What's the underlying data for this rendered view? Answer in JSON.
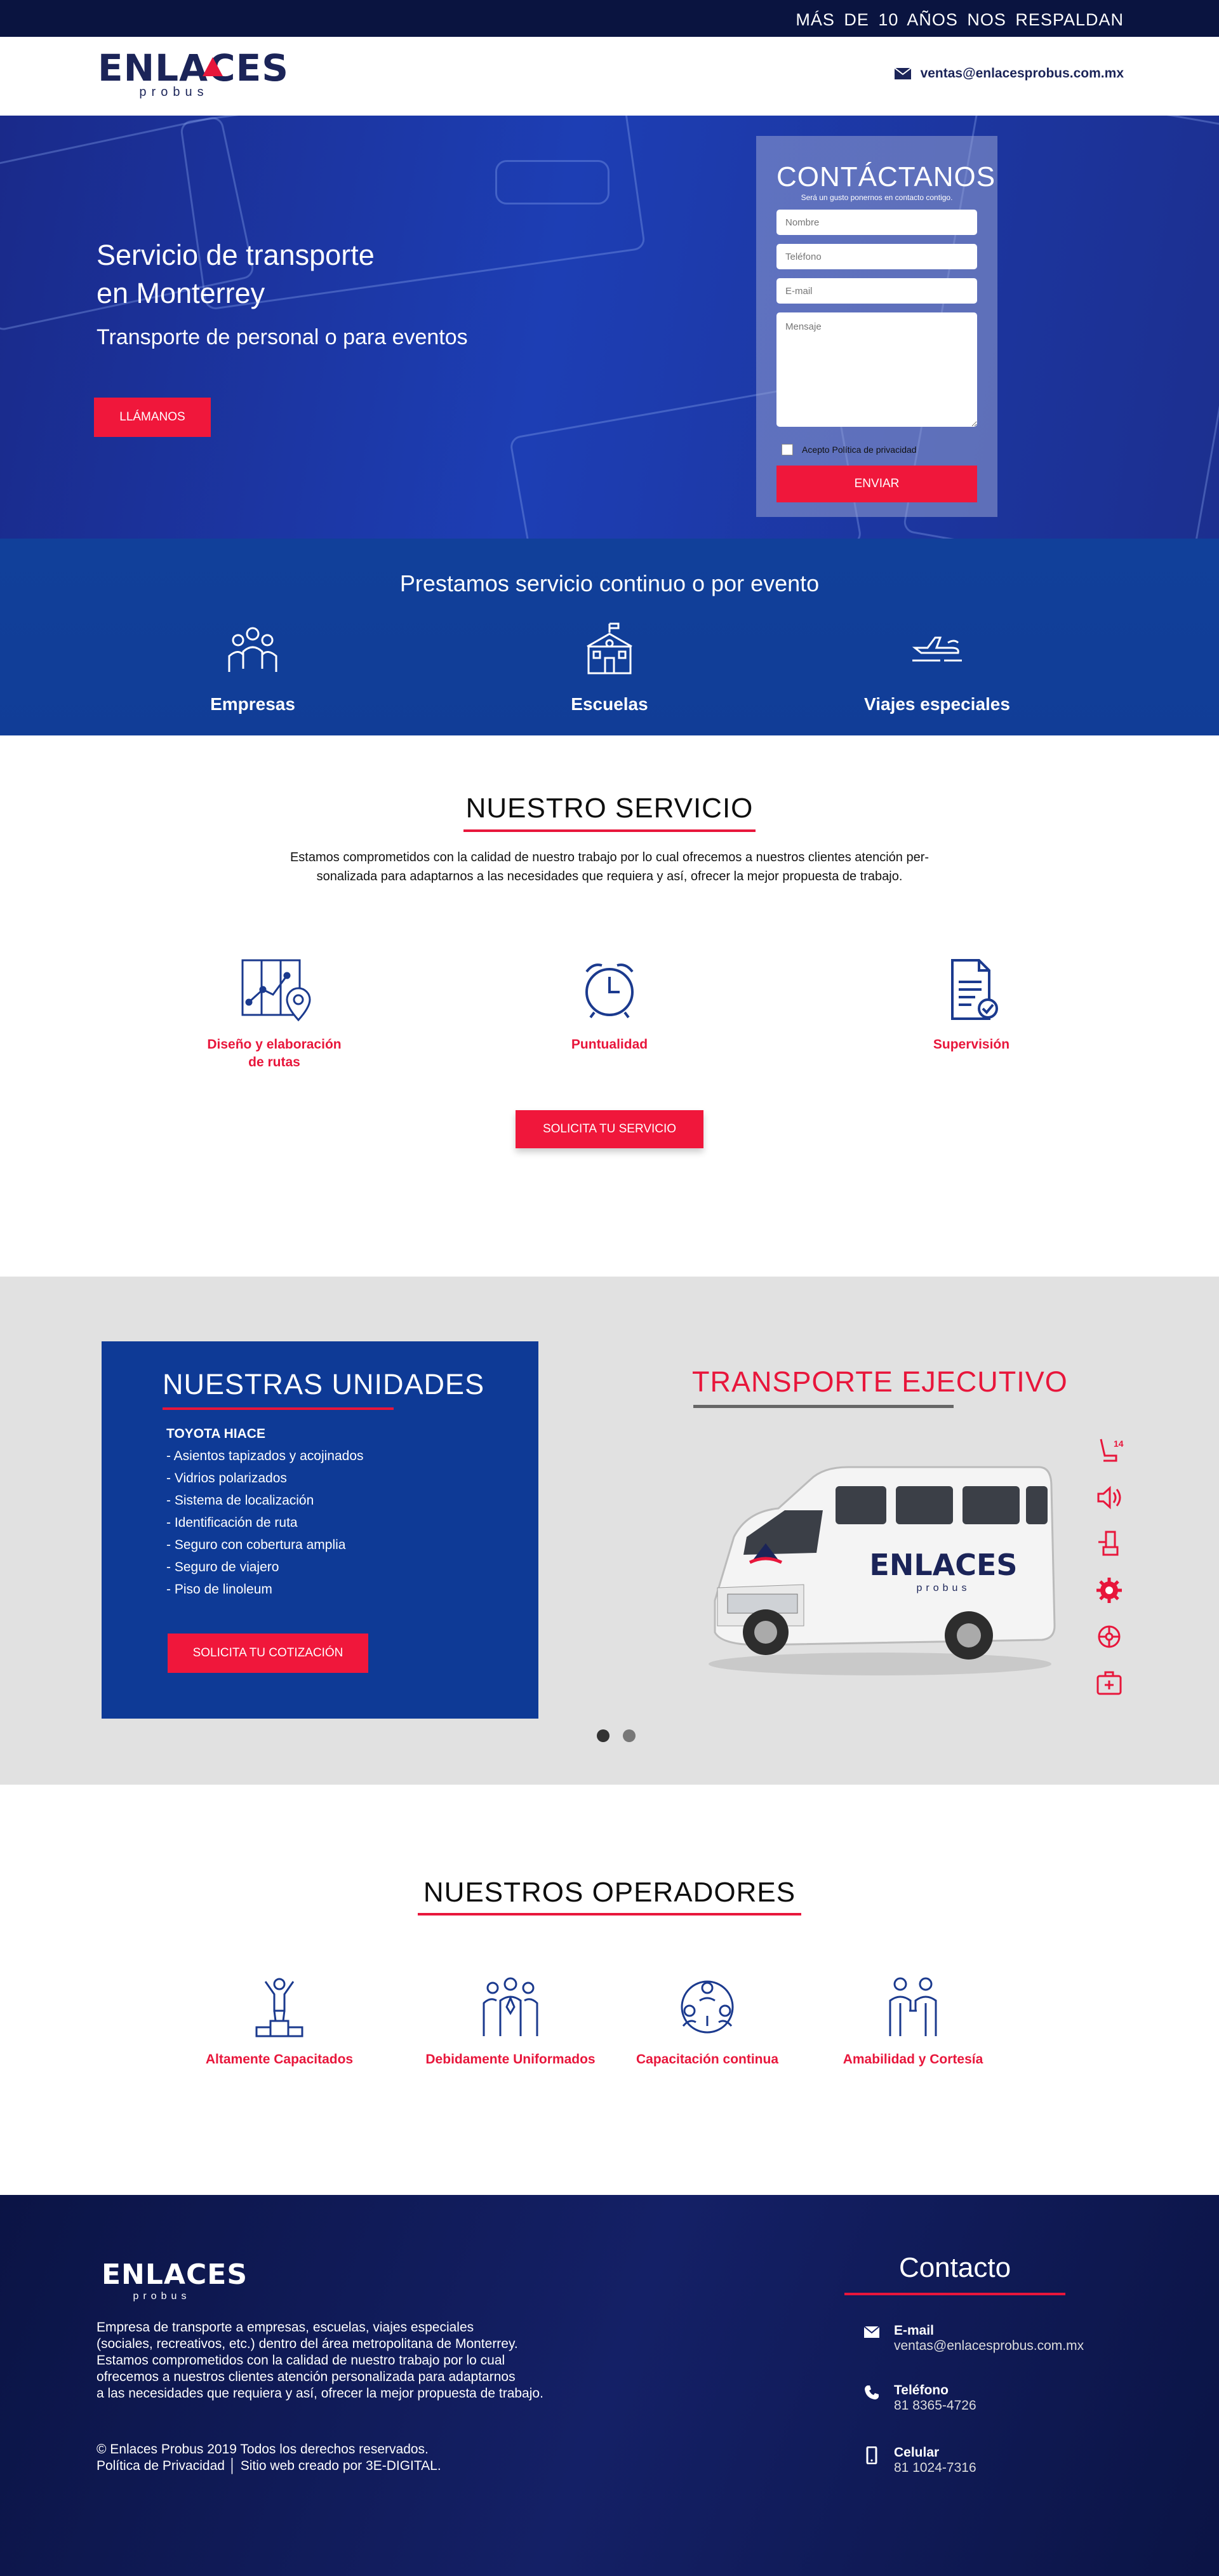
{
  "topbar": {
    "text": "MÁS DE 10 AÑOS NOS RESPALDAN"
  },
  "brand": {
    "name": "ENLACES",
    "sub": "probus"
  },
  "header": {
    "email": "ventas@enlacesprobus.com.mx"
  },
  "hero": {
    "title_line1": "Servicio de transporte",
    "title_line2": "en Monterrey",
    "subtitle": "Transporte de personal o para eventos",
    "cta": "LLÁMANOS"
  },
  "contact_form": {
    "title": "CONTÁCTANOS",
    "subtitle": "Será un gusto ponernos en contacto contigo.",
    "name_placeholder": "Nombre",
    "phone_placeholder": "Teléfono",
    "email_placeholder": "E-mail",
    "message_placeholder": "Mensaje",
    "privacy_label": "Acepto Política de privacidad",
    "submit": "ENVIAR"
  },
  "services_band": {
    "title": "Prestamos servicio continuo o por evento",
    "items": [
      {
        "label": "Empresas",
        "icon": "people-group-icon"
      },
      {
        "label": "Escuelas",
        "icon": "school-icon"
      },
      {
        "label": "Viajes especiales",
        "icon": "plane-icon"
      }
    ]
  },
  "nuestro_servicio": {
    "title": "NUESTRO SERVICIO",
    "paragraph_line1": "Estamos comprometidos con la calidad de nuestro trabajo por lo cual ofrecemos a nuestros clientes atención per-",
    "paragraph_line2": "sonalizada para adaptarnos a las necesidades que requiera y así, ofrecer la mejor propuesta de trabajo.",
    "features": [
      {
        "label_line1": "Diseño y elaboración",
        "label_line2": "de rutas",
        "icon": "route-map-icon"
      },
      {
        "label_line1": "Puntualidad",
        "label_line2": "",
        "icon": "alarm-clock-icon"
      },
      {
        "label_line1": "Supervisión",
        "label_line2": "",
        "icon": "checklist-document-icon"
      }
    ],
    "cta": "SOLICITA TU SERVICIO"
  },
  "unidades": {
    "title": "NUESTRAS UNIDADES",
    "model": "TOYOTA HIACE",
    "specs": [
      "- Asientos tapizados y acojinados",
      "- Vidrios polarizados",
      "- Sistema de localización",
      "- Identificación de ruta",
      "- Seguro con cobertura amplia",
      "- Seguro de viajero",
      "- Piso de linoleum"
    ],
    "cta": "SOLICITA TU COTIZACIÓN",
    "right_title": "TRANSPORTE EJECUTIVO",
    "seat_count": "14",
    "van_brand": "ENLACES",
    "van_sub": "probus",
    "feature_icons": [
      "seat-icon",
      "speaker-icon",
      "usb-icon",
      "gear-icon",
      "ac-icon",
      "first-aid-icon"
    ]
  },
  "operadores": {
    "title": "NUESTROS OPERADORES",
    "items": [
      {
        "label": "Altamente Capacitados",
        "icon": "podium-person-icon"
      },
      {
        "label": "Debidamente Uniformados",
        "icon": "uniform-team-icon"
      },
      {
        "label": "Capacitación continua",
        "icon": "training-circle-icon"
      },
      {
        "label": "Amabilidad y Cortesía",
        "icon": "handshake-people-icon"
      }
    ]
  },
  "footer": {
    "description_lines": [
      "Empresa de transporte a empresas, escuelas, viajes especiales",
      "(sociales, recreativos, etc.) dentro del área metropolitana de Monterrey.",
      "Estamos comprometidos con la calidad de nuestro trabajo por lo cual",
      "ofrecemos a nuestros clientes atención personalizada para adaptarnos",
      "a las necesidades que requiera y así, ofrecer la mejor propuesta de trabajo."
    ],
    "copyright": "© Enlaces Probus 2019 Todos los derechos reservados.",
    "links": "Política de Privacidad │ Sitio web creado por 3E-DIGITAL.",
    "contact_title": "Contacto",
    "contact": [
      {
        "label": "E-mail",
        "value": "ventas@enlacesprobus.com.mx",
        "icon": "envelope-icon"
      },
      {
        "label": "Teléfono",
        "value": "81 8365-4726",
        "icon": "phone-icon"
      },
      {
        "label": "Celular",
        "value": "81 1024-7316",
        "icon": "mobile-icon"
      }
    ]
  },
  "colors": {
    "navy": "#0a1440",
    "blue": "#0e3a96",
    "red": "#e8163b"
  }
}
